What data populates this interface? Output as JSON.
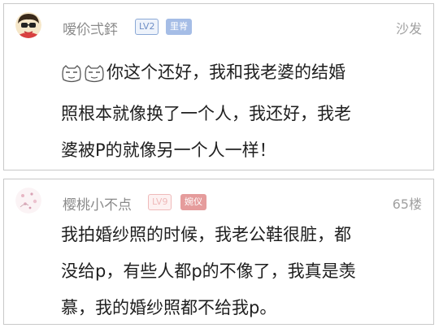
{
  "comments": [
    {
      "username": "嗳伱弍銔",
      "level": "LV2",
      "user_title": "里脊",
      "floor": "沙发",
      "emoji": [
        "cool-smile-emoji",
        "cool-smile-emoji"
      ],
      "lines": [
        "你这个还好，我和我老婆的结婚",
        "照根本就像换了一个人，我还好，我老",
        "婆被P的就像另一个人一样！"
      ]
    },
    {
      "username": "樱桃小不点",
      "level": "LV9",
      "user_title": "婉仪",
      "floor": "65楼",
      "lines": [
        "我拍婚纱照的时候，我老公鞋很脏，都",
        "没给p，有些人都p的不像了，我真是羡",
        "慕，我的婚纱照都不给我p。"
      ]
    }
  ]
}
